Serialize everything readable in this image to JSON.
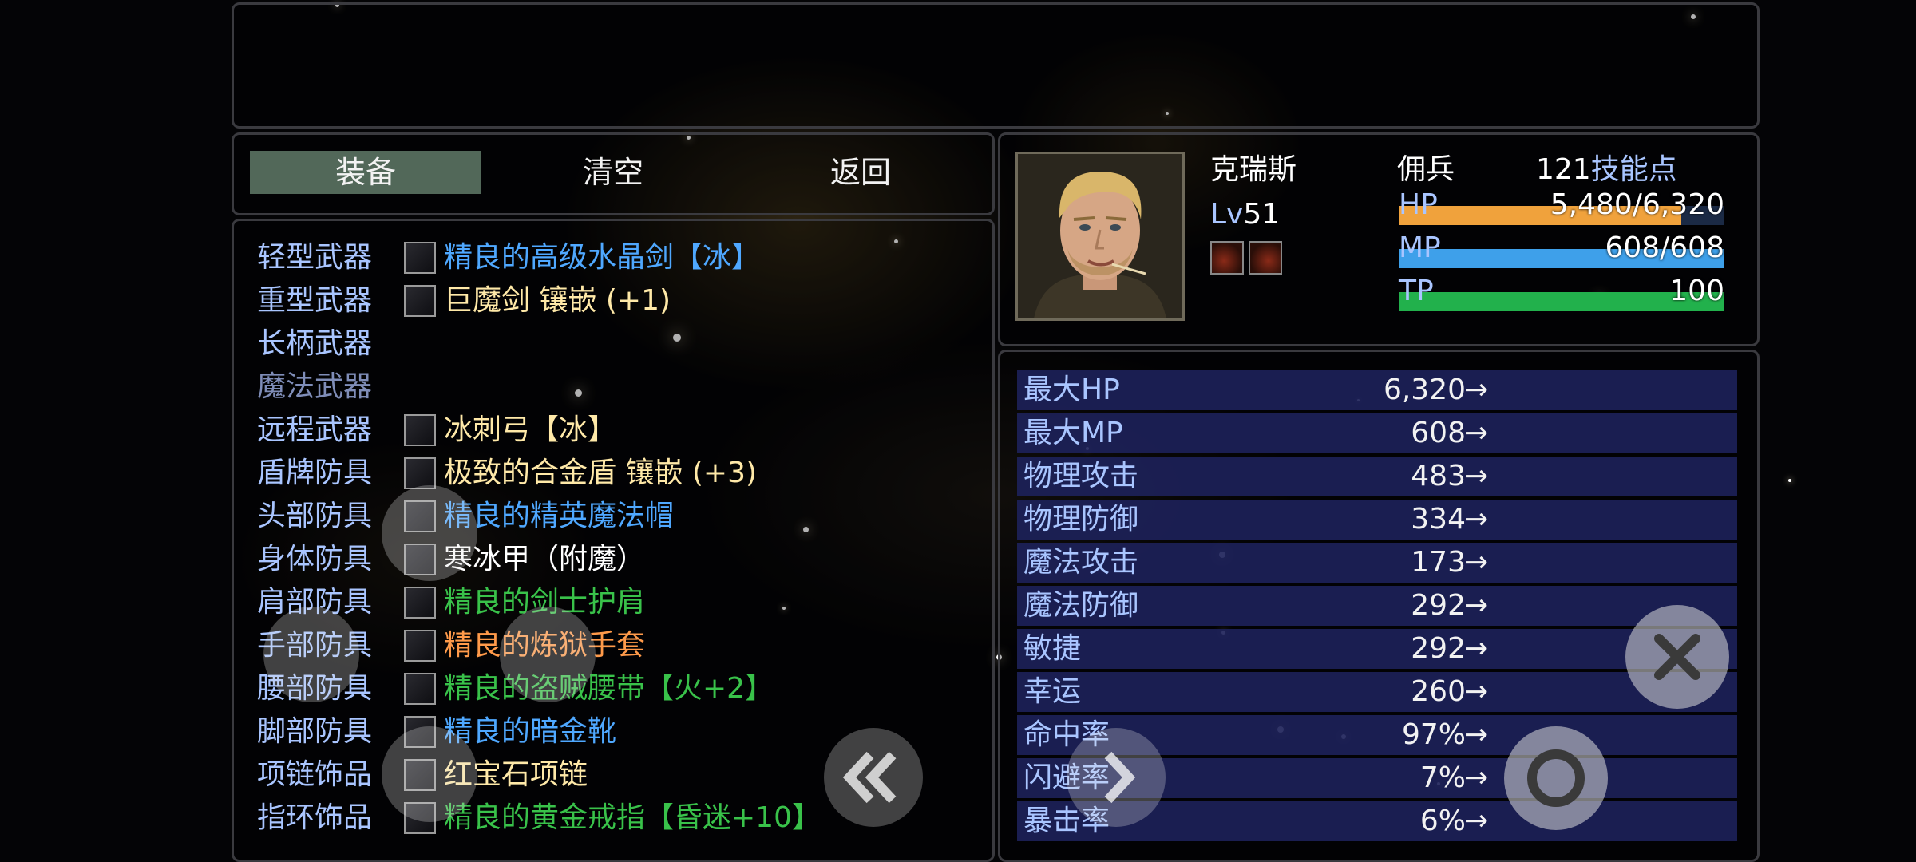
{
  "commands": [
    "装备",
    "清空",
    "返回"
  ],
  "equipment": [
    {
      "slot": "轻型武器",
      "item": "精良的高级水晶剑【冰】",
      "color": "#4fa8ff",
      "icon": "sword-icon",
      "dim": false
    },
    {
      "slot": "重型武器",
      "item": "巨魔剑 镶嵌 (+1)",
      "color": "#ffe9a8",
      "icon": "greatsword-icon",
      "dim": false
    },
    {
      "slot": "长柄武器",
      "item": "",
      "color": "#ffffff",
      "icon": "",
      "dim": false
    },
    {
      "slot": "魔法武器",
      "item": "",
      "color": "#ffffff",
      "icon": "",
      "dim": true
    },
    {
      "slot": "远程武器",
      "item": "冰刺弓【冰】",
      "color": "#ffe9a8",
      "icon": "bow-icon",
      "dim": false
    },
    {
      "slot": "盾牌防具",
      "item": "极致的合金盾 镶嵌 (+3)",
      "color": "#ffe9a8",
      "icon": "shield-icon",
      "dim": false
    },
    {
      "slot": "头部防具",
      "item": "精良的精英魔法帽",
      "color": "#4fa8ff",
      "icon": "hat-icon",
      "dim": false
    },
    {
      "slot": "身体防具",
      "item": "寒冰甲（附魔）",
      "color": "#ffffff",
      "icon": "armor-icon",
      "dim": false
    },
    {
      "slot": "肩部防具",
      "item": "精良的剑士护肩",
      "color": "#39c24a",
      "icon": "shoulder-icon",
      "dim": false
    },
    {
      "slot": "手部防具",
      "item": "精良的炼狱手套",
      "color": "#ff9a4a",
      "icon": "gloves-icon",
      "dim": false
    },
    {
      "slot": "腰部防具",
      "item": "精良的盗贼腰带【火+2】",
      "color": "#39c24a",
      "icon": "belt-icon",
      "dim": false
    },
    {
      "slot": "脚部防具",
      "item": "精良的暗金靴",
      "color": "#4fa8ff",
      "icon": "boots-icon",
      "dim": false
    },
    {
      "slot": "项链饰品",
      "item": "红宝石项链",
      "color": "#ffe9a8",
      "icon": "necklace-icon",
      "dim": false
    },
    {
      "slot": "指环饰品",
      "item": "精良的黄金戒指【昏迷+10】",
      "color": "#39c24a",
      "icon": "ring-icon",
      "dim": false
    }
  ],
  "character": {
    "name": "克瑞斯",
    "class": "佣兵",
    "skill_points": "121",
    "skill_points_label": "技能点",
    "level_prefix": "Lv",
    "level": "51",
    "hp_label": "HP",
    "hp_value": "5,480/6,320",
    "hp_fraction": 0.867,
    "mp_label": "MP",
    "mp_value": "608/608",
    "mp_fraction": 1.0,
    "tp_label": "TP",
    "tp_value": "100",
    "tp_fraction": 1.0
  },
  "stats": [
    {
      "label": "最大HP",
      "value": "6,320"
    },
    {
      "label": "最大MP",
      "value": "608"
    },
    {
      "label": "物理攻击",
      "value": "483"
    },
    {
      "label": "物理防御",
      "value": "334"
    },
    {
      "label": "魔法攻击",
      "value": "173"
    },
    {
      "label": "魔法防御",
      "value": "292"
    },
    {
      "label": "敏捷",
      "value": "292"
    },
    {
      "label": "幸运",
      "value": "260"
    },
    {
      "label": "命中率",
      "value": "97%"
    },
    {
      "label": "闪避率",
      "value": "7%"
    },
    {
      "label": "暴击率",
      "value": "6%"
    }
  ],
  "stat_arrow": "→",
  "colors": {
    "label_blue": "#a9c5ff",
    "hp_bar": "#f0a23c",
    "mp_bar": "#3ea0ea",
    "tp_bar": "#22b14c",
    "stat_row": "#1e225c"
  }
}
